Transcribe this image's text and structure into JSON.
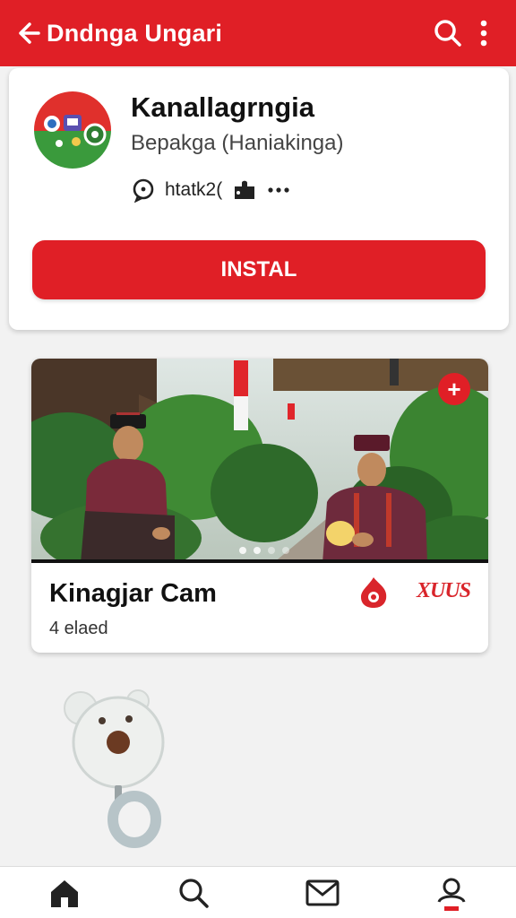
{
  "header": {
    "title": "Dndnga Ungari",
    "back_icon": "arrow-left-icon",
    "search_icon": "search-icon",
    "menu_icon": "more-vertical-icon",
    "color": "#e01f26"
  },
  "app": {
    "name": "Kanallagrngia",
    "developer": "Bepakga (Haniakinga)",
    "meta_text": "htatk2(",
    "install_label": "INSTAL"
  },
  "media": {
    "title": "Kinagjar Cam",
    "subtitle": "4 elaed",
    "brand_text": "XUUS"
  },
  "nav": {
    "items": [
      "home-icon",
      "search-icon",
      "mail-icon",
      "profile-icon"
    ]
  }
}
